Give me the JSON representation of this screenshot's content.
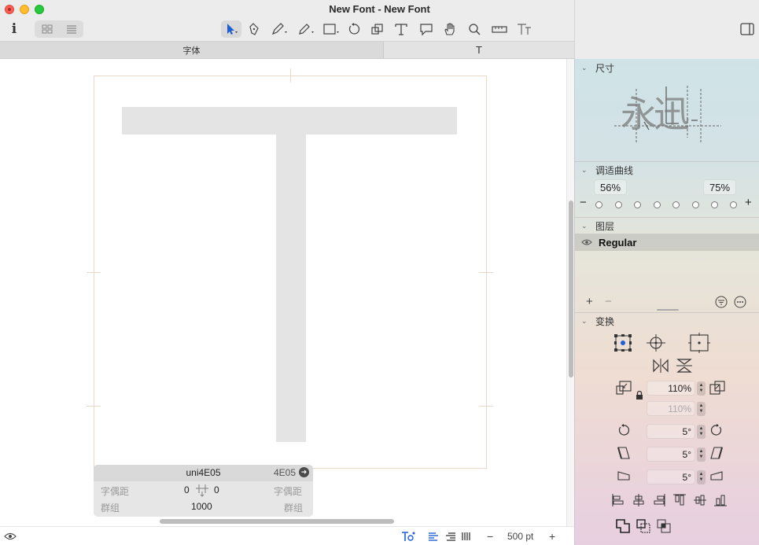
{
  "window": {
    "title": "New Font"
  },
  "toolbar": {
    "info_icon": "i",
    "tools": [
      "select-tool-icon",
      "draw-tool-icon",
      "pen-tool-icon",
      "pencil-tool-icon",
      "rectangle-tool-icon",
      "rotate-tool-icon",
      "scale-tool-icon",
      "text-tool-icon",
      "annotation-tool-icon",
      "hand-tool-icon",
      "zoom-tool-icon",
      "measure-tool-icon",
      "type-tool-icon"
    ]
  },
  "tabs": [
    {
      "label": "字体"
    },
    {
      "label": "T"
    }
  ],
  "glyph_info": {
    "name": "uni4E05",
    "unicode": "4E05",
    "left_kerning_label": "字偶距",
    "left_sb": "0",
    "right_sb": "0",
    "right_kerning_label": "字偶距",
    "left_group_label": "群组",
    "width": "1000",
    "right_group_label": "群组"
  },
  "bottombar": {
    "zoom": "500 pt",
    "minus": "−",
    "plus": "+"
  },
  "panel": {
    "dimensions": {
      "title": "尺寸",
      "sample": "永迅"
    },
    "tuning_curves": {
      "title": "调适曲线",
      "left": "56%",
      "right": "75%",
      "minus": "−",
      "plus": "+"
    },
    "layers": {
      "title": "图层",
      "items": [
        {
          "name": "Regular"
        }
      ],
      "add": "+",
      "remove": "−"
    },
    "transform": {
      "title": "变换",
      "scale_x": "110%",
      "scale_y": "110%",
      "rotate": "5°",
      "slant": "5°",
      "skew": "5°"
    }
  },
  "colors": {
    "accent": "#1f5fd6",
    "glyph_fill": "#e4e4e4",
    "metrics_line": "#ead9c6"
  }
}
